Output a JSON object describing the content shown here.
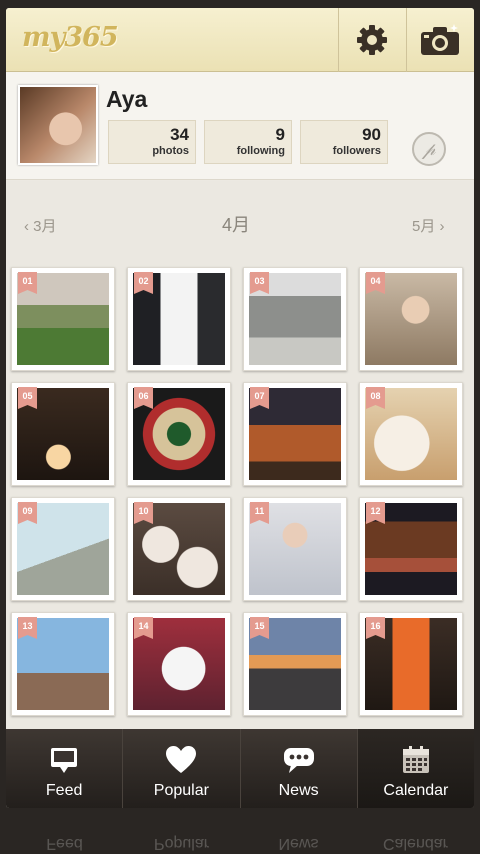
{
  "header": {
    "logo": "my365",
    "settings_icon": "gear-icon",
    "camera_icon": "camera-icon"
  },
  "profile": {
    "username": "Aya",
    "stats": [
      {
        "value": "34",
        "label": "photos"
      },
      {
        "value": "9",
        "label": "following"
      },
      {
        "value": "90",
        "label": "followers"
      }
    ],
    "pinterest_icon": "pinterest-icon"
  },
  "month_nav": {
    "prev": "3月",
    "current": "4月",
    "next": "5月"
  },
  "days": [
    "01",
    "02",
    "03",
    "04",
    "05",
    "06",
    "07",
    "08",
    "09",
    "10",
    "11",
    "12",
    "13",
    "14",
    "15",
    "16"
  ],
  "bottom_nav": [
    {
      "label": "Feed",
      "icon": "feed-icon"
    },
    {
      "label": "Popular",
      "icon": "heart-icon"
    },
    {
      "label": "News",
      "icon": "chat-bubble-icon"
    },
    {
      "label": "Calendar",
      "icon": "calendar-icon"
    }
  ]
}
